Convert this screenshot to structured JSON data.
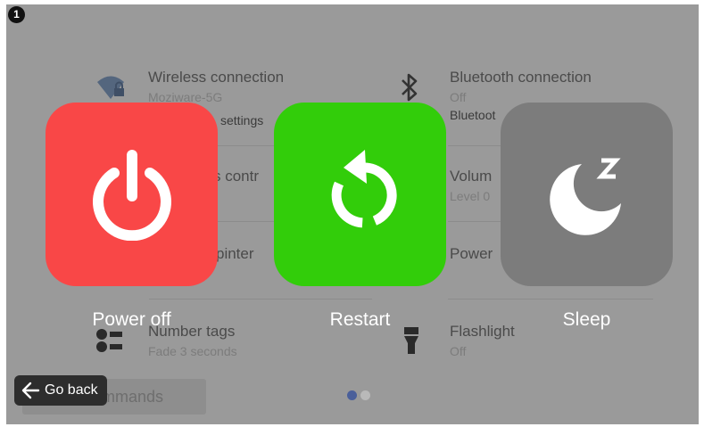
{
  "badge": {
    "number": "1"
  },
  "background": {
    "wireless": {
      "title": "Wireless connection",
      "status": "Moziware-5G",
      "settings_link": "settings"
    },
    "bluetooth": {
      "title": "Bluetooth connection",
      "status": "Off",
      "settings_link": "Bluetoot"
    },
    "row2_left": {
      "title": "s contr"
    },
    "volume": {
      "title": "Volum",
      "status": "Level 0"
    },
    "row3_left": {
      "title": "pinter"
    },
    "power": {
      "title": "Power"
    },
    "number_tags": {
      "title": "Number tags",
      "status": "Fade 3 seconds"
    },
    "flashlight": {
      "title": "Flashlight",
      "status": "Off"
    },
    "commands_button": "commands"
  },
  "overlay": {
    "power_off": {
      "label": "Power off",
      "color": "#f94747",
      "icon": "power-icon"
    },
    "restart": {
      "label": "Restart",
      "color": "#32cd0a",
      "icon": "restart-icon"
    },
    "sleep": {
      "label": "Sleep",
      "color": "#7c7c7c",
      "icon": "sleep-moon-icon"
    }
  },
  "pager": {
    "pages": 2,
    "current": 1
  },
  "go_back": {
    "label": "Go back",
    "icon": "arrow-left-icon"
  }
}
